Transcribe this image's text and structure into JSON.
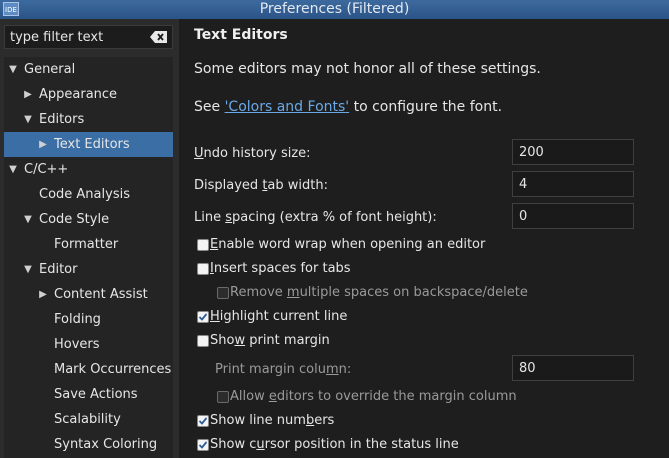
{
  "window": {
    "title": "Preferences (Filtered)",
    "app_icon_text": "IDE"
  },
  "filter": {
    "placeholder": "type filter text"
  },
  "tree": [
    {
      "label": "General",
      "expanded": true
    },
    {
      "label": "Appearance",
      "expanded": false
    },
    {
      "label": "Editors",
      "expanded": true
    },
    {
      "label": "Text Editors",
      "expanded": false,
      "selected": true
    },
    {
      "label": "C/C++",
      "expanded": true
    },
    {
      "label": "Code Analysis"
    },
    {
      "label": "Code Style",
      "expanded": true
    },
    {
      "label": "Formatter"
    },
    {
      "label": "Editor",
      "expanded": true
    },
    {
      "label": "Content Assist",
      "expanded": false
    },
    {
      "label": "Folding"
    },
    {
      "label": "Hovers"
    },
    {
      "label": "Mark Occurrences"
    },
    {
      "label": "Save Actions"
    },
    {
      "label": "Scalability"
    },
    {
      "label": "Syntax Coloring"
    }
  ],
  "page": {
    "title": "Text Editors",
    "note": "Some editors may not honor all of these settings.",
    "see_prefix": "See ",
    "see_link": "'Colors and Fonts'",
    "see_suffix": " to configure the font."
  },
  "fields": {
    "undo": {
      "label_u": "U",
      "label_rest": "ndo history size:",
      "value": "200"
    },
    "tab": {
      "label_pre": "Displayed ",
      "label_u": "t",
      "label_rest": "ab width:",
      "value": "4"
    },
    "spacing": {
      "label_pre": "Line ",
      "label_u": "s",
      "label_rest": "pacing (extra % of font height):",
      "value": "0"
    },
    "margin": {
      "label_pre": "Print margin colu",
      "label_u": "m",
      "label_rest": "n:",
      "value": "80"
    }
  },
  "checkboxes": {
    "word_wrap": {
      "pre": "",
      "u": "E",
      "rest": "nable word wrap when opening an editor",
      "checked": false
    },
    "spaces": {
      "pre": "",
      "u": "I",
      "rest": "nsert spaces for tabs",
      "checked": false
    },
    "remove_spaces": {
      "pre": "Remove ",
      "u": "m",
      "rest": "ultiple spaces on backspace/delete",
      "checked": false
    },
    "highlight": {
      "pre": "",
      "u": "H",
      "rest": "ighlight current line",
      "checked": true
    },
    "print_margin": {
      "pre": "Sho",
      "u": "w",
      "rest": " print margin",
      "checked": false
    },
    "allow_override": {
      "pre": "Allow ",
      "u": "e",
      "rest": "ditors to override the margin column",
      "checked": false
    },
    "line_numbers": {
      "pre": "Show line num",
      "u": "b",
      "rest": "ers",
      "checked": true
    },
    "cursor_pos": {
      "pre": "Show c",
      "u": "u",
      "rest": "rsor position in the status line",
      "checked": true
    }
  }
}
